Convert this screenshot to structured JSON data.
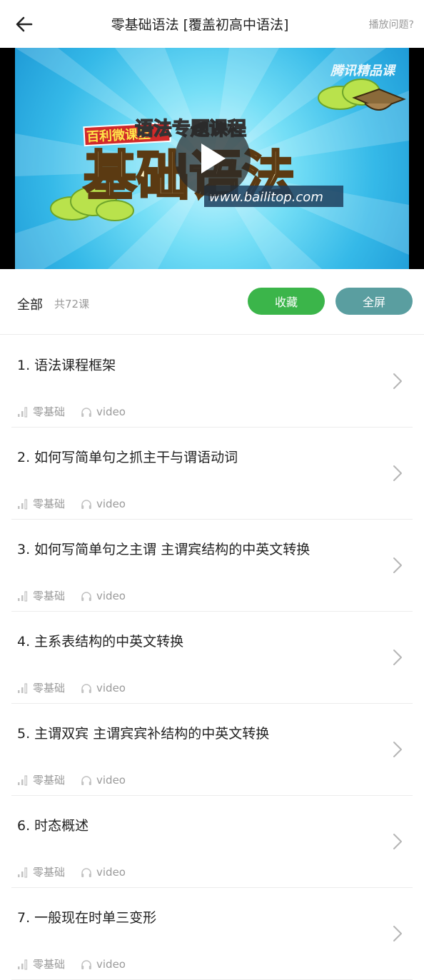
{
  "header": {
    "title": "零基础语法 [覆盖初高中语法]",
    "help": "播放问题?"
  },
  "video": {
    "badge": "百利微课堂",
    "big_text": "基础语法",
    "url_text": "www.bailitop.com",
    "corner": "腾讯精品课",
    "banner": "语法专题课程"
  },
  "toolbar": {
    "all_label": "全部",
    "count_label": "共72课",
    "favorite_label": "收藏",
    "fullscreen_label": "全屏"
  },
  "lessons": [
    {
      "title": "1. 语法课程框架",
      "level": "零基础",
      "type": "video"
    },
    {
      "title": "2. 如何写简单句之抓主干与谓语动词",
      "level": "零基础",
      "type": "video"
    },
    {
      "title": "3. 如何写简单句之主谓 主谓宾结构的中英文转换",
      "level": "零基础",
      "type": "video"
    },
    {
      "title": "4. 主系表结构的中英文转换",
      "level": "零基础",
      "type": "video"
    },
    {
      "title": "5. 主谓双宾 主谓宾宾补结构的中英文转换",
      "level": "零基础",
      "type": "video"
    },
    {
      "title": "6. 时态概述",
      "level": "零基础",
      "type": "video"
    },
    {
      "title": "7. 一般现在时单三变形",
      "level": "零基础",
      "type": "video"
    }
  ],
  "colors": {
    "favorite_button": "#3bb54a",
    "fullscreen_button": "#5a9ea0",
    "muted_text": "#9a9a9a"
  },
  "icons": {
    "back": "arrow-left-icon",
    "play": "play-icon",
    "level": "signal-bars-icon",
    "media": "headphones-icon",
    "chevron": "chevron-right-icon"
  }
}
